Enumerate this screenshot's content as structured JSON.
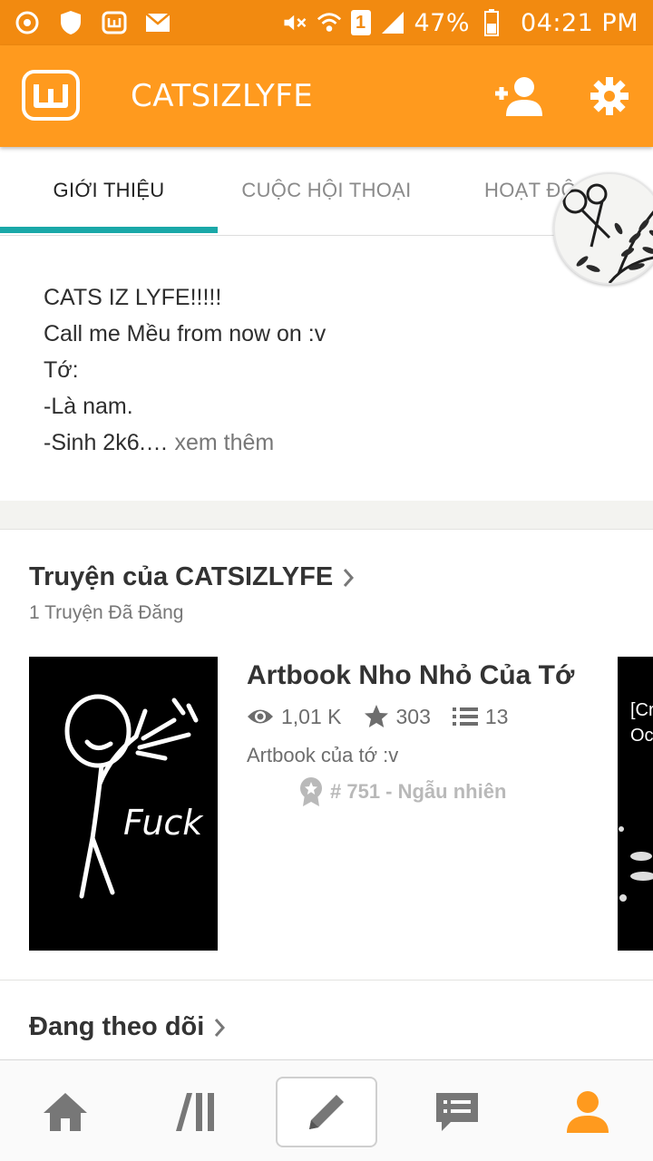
{
  "status_bar": {
    "battery_percent": "47%",
    "time": "04:21 PM",
    "sim_label": "1",
    "icons": [
      "chrome-icon",
      "shield-icon",
      "wattpad-icon",
      "mail-icon",
      "mute-icon",
      "wifi-icon",
      "signal-icon",
      "battery-icon"
    ]
  },
  "header": {
    "title": "CATSIZLYFE",
    "accent_color": "#ff9a1e"
  },
  "tabs": [
    {
      "label": "GIỚI THIỆU",
      "active": true
    },
    {
      "label": "CUỘC HỘI THOẠI",
      "active": false
    },
    {
      "label": "HOẠT ĐỘ",
      "active": false
    }
  ],
  "about": {
    "line1": "CATS IZ LYFE!!!!!",
    "line2": "Call me Mều from now on :v",
    "line3": "Tớ:",
    "line4": "-Là nam.",
    "line5": "-Sinh 2k6.…",
    "more_link": " xem thêm"
  },
  "stories_section": {
    "title": "Truyện của CATSIZLYFE",
    "subtitle": "1 Truyện Đã Đăng",
    "story": {
      "title": "Artbook Nho Nhỏ Của Tớ",
      "views": "1,01 K",
      "votes": "303",
      "parts": "13",
      "description": "Artbook của tớ :v",
      "rank": "# 751 - Ngẫu nhiên",
      "cover_text": "Fuck"
    },
    "next_cover_text": [
      "[Cr",
      "Oc"
    ]
  },
  "following_section": {
    "title": "Đang theo dõi"
  },
  "bottom_nav": {
    "items": [
      "home-icon",
      "library-icon",
      "write-icon",
      "messages-icon",
      "profile-icon"
    ],
    "active": "profile-icon"
  }
}
